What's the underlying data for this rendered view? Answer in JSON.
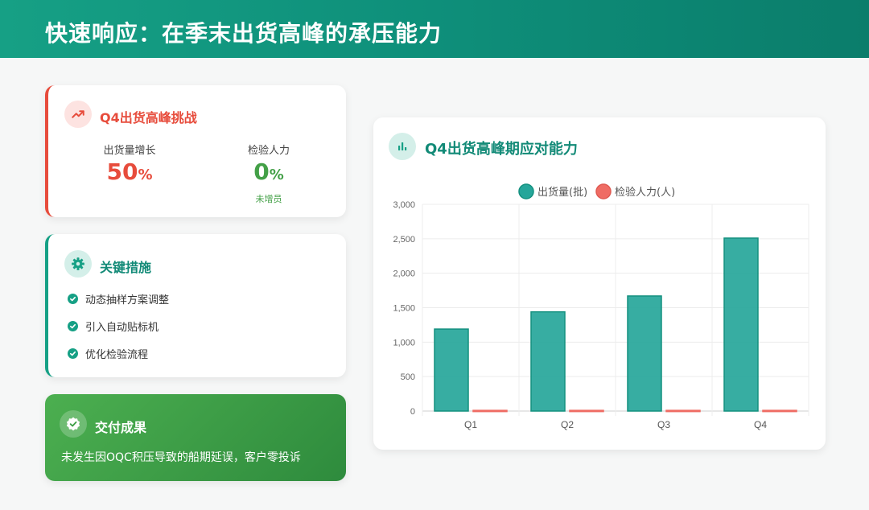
{
  "header": {
    "title": "快速响应：在季末出货高峰的承压能力"
  },
  "challenge": {
    "title": "Q4出货高峰挑战",
    "icon": "trend-up-icon",
    "stats": [
      {
        "label": "出货量增长",
        "value": "50",
        "unit": "%",
        "color": "#e74c3c",
        "note": ""
      },
      {
        "label": "检验人力",
        "value": "0",
        "unit": "%",
        "color": "#43a047",
        "note": "未增员"
      }
    ]
  },
  "measures": {
    "title": "关键措施",
    "icon": "gear-icon",
    "items": [
      "动态抽样方案调整",
      "引入自动贴标机",
      "优化检验流程"
    ]
  },
  "result": {
    "title": "交付成果",
    "icon": "badge-check-icon",
    "text": "未发生因OQC积压导致的船期延误，客户零投诉"
  },
  "chart": {
    "title": "Q4出货高峰期应对能力",
    "icon": "bar-chart-icon"
  },
  "chart_data": {
    "type": "bar",
    "categories": [
      "Q1",
      "Q2",
      "Q3",
      "Q4"
    ],
    "series": [
      {
        "name": "出货量(批)",
        "values": [
          1190,
          1440,
          1670,
          2510
        ],
        "color": "#26a69a"
      },
      {
        "name": "检验人力(人)",
        "values": [
          10,
          10,
          10,
          10
        ],
        "color": "#ef6c64"
      }
    ],
    "ylim": [
      0,
      3000
    ],
    "yticks": [
      "0",
      "500",
      "1,000",
      "1,500",
      "2,000",
      "2,500",
      "3,000"
    ],
    "grid": true,
    "legend": "top-center"
  }
}
